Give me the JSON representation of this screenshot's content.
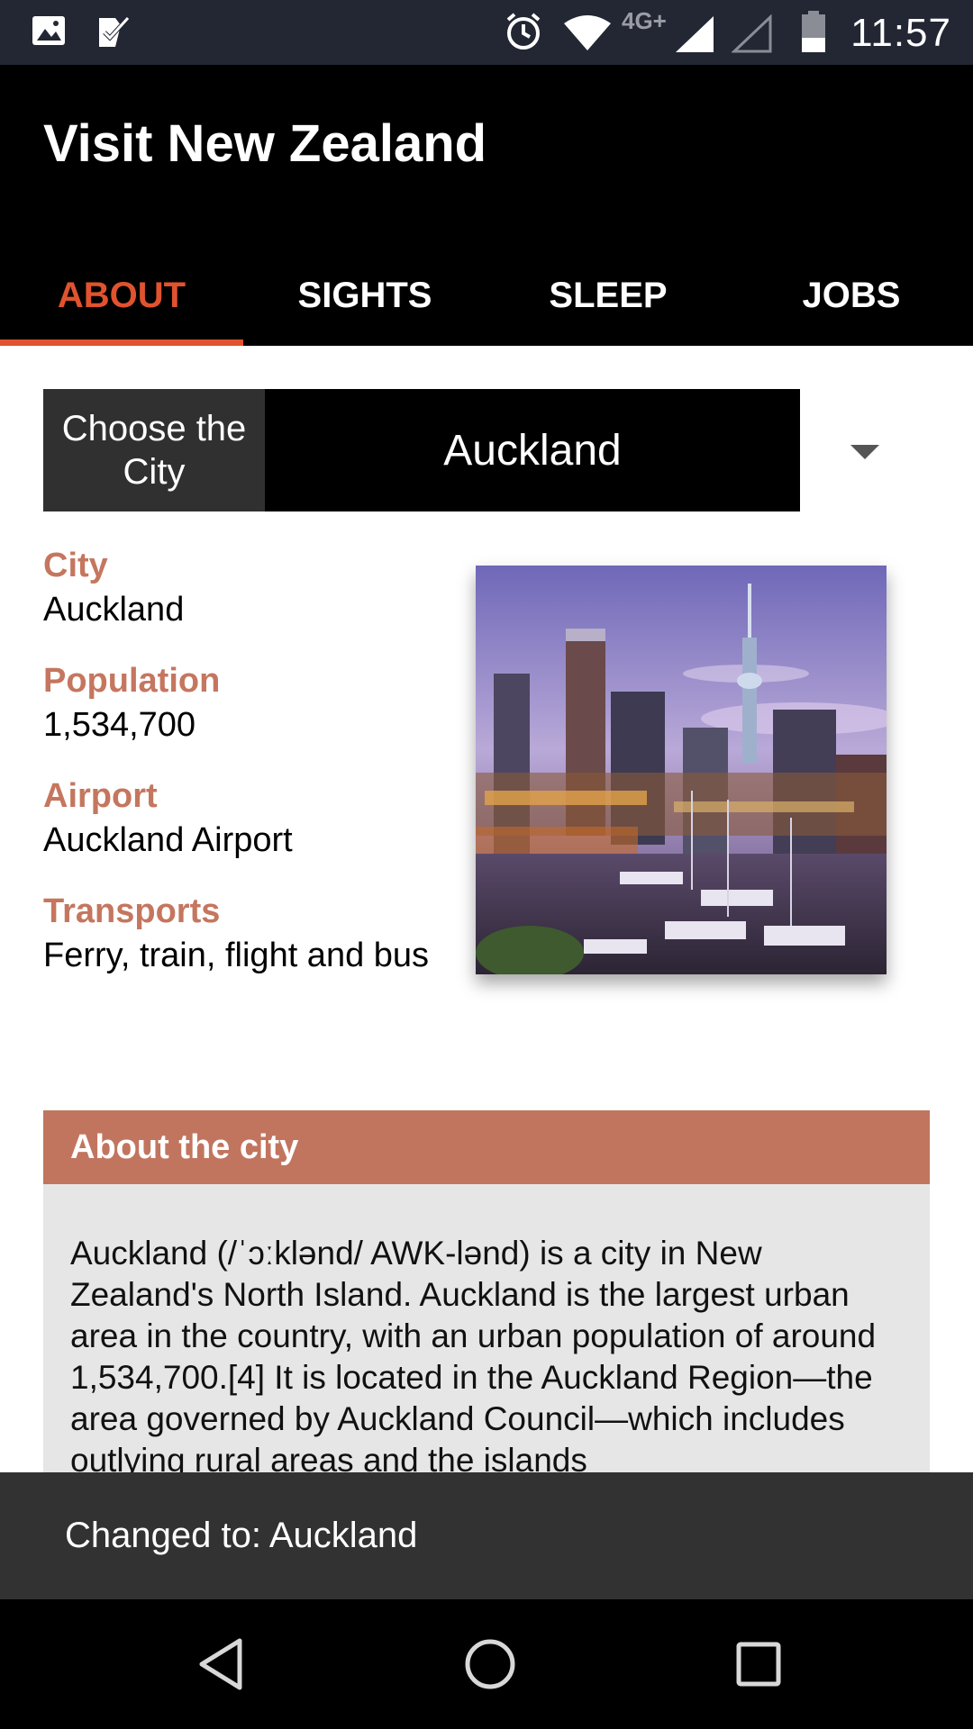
{
  "status_bar": {
    "time": "11:57",
    "network": "4G+",
    "icons": [
      "gallery-icon",
      "checklist-icon",
      "alarm-icon",
      "wifi-icon",
      "signal-icon",
      "signal-empty-icon",
      "battery-icon"
    ]
  },
  "app": {
    "title": "Visit New Zealand"
  },
  "tabs": [
    {
      "label": "ABOUT",
      "active": true
    },
    {
      "label": "SIGHTS",
      "active": false
    },
    {
      "label": "SLEEP",
      "active": false
    },
    {
      "label": "JOBS",
      "active": false
    }
  ],
  "chooser": {
    "label": "Choose the City",
    "selected": "Auckland"
  },
  "details": [
    {
      "label": "City",
      "value": "Auckland"
    },
    {
      "label": "Population",
      "value": "1,534,700"
    },
    {
      "label": "Airport",
      "value": "Auckland Airport"
    },
    {
      "label": "Transports",
      "value": "Ferry, train, flight and bus"
    }
  ],
  "about": {
    "header": "About the city",
    "text": "Auckland (/ˈɔːklənd/ AWK-lənd) is a city in New Zealand's North Island. Auckland is the largest urban area in the country, with an urban population of around 1,534,700.[4] It is located in the Auckland Region—the area governed by Auckland Council—which includes outlying rural areas and the islands"
  },
  "snackbar": {
    "message": "Changed to: Auckland"
  },
  "colors": {
    "accent": "#e0532e",
    "label": "#c5765f",
    "about_header": "#c2755e",
    "app_bar": "#000000",
    "status_bar": "#232733"
  }
}
